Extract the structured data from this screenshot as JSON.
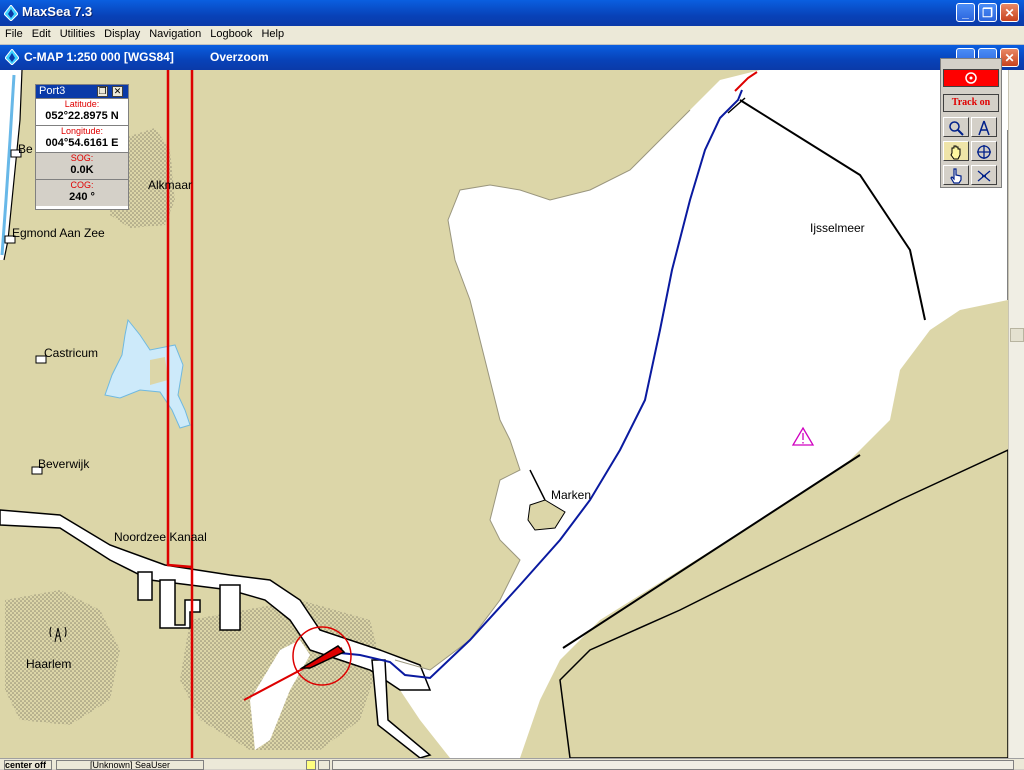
{
  "window": {
    "title": "MaxSea 7.3",
    "min_label": "_",
    "max_label": "❐",
    "close_label": "✕"
  },
  "menu": [
    "File",
    "Edit",
    "Utilities",
    "Display",
    "Navigation",
    "Logbook",
    "Help"
  ],
  "chart_window": {
    "title": "C-MAP  1:250 000 [WGS84]",
    "mode": "Overzoom"
  },
  "port_panel": {
    "title": "Port3",
    "latitude_label": "Latitude:",
    "latitude": "052°22.8975 N",
    "longitude_label": "Longitude:",
    "longitude": "004°54.6161 E",
    "sog_label": "SOG:",
    "sog": "0.0K",
    "cog_label": "COG:",
    "cog": "240 °"
  },
  "tools": {
    "track_label": "Track on"
  },
  "map_labels": {
    "bergen": "Be",
    "alkmaar": "Alkmaar",
    "egmond": "Egmond Aan Zee",
    "castricum": "Castricum",
    "beverwijk": "Beverwijk",
    "noordzee": "Noordzee Kanaal",
    "haarlem": "Haarlem",
    "marken": "Marken",
    "ijsselmeer": "Ijsselmeer"
  },
  "status": {
    "center": "center off",
    "user": "[Unknown] SeaUser"
  },
  "colors": {
    "land": "#dcd6a8",
    "water": "#ffffff",
    "track": "#0a1aa0",
    "boat": "#e00000"
  }
}
